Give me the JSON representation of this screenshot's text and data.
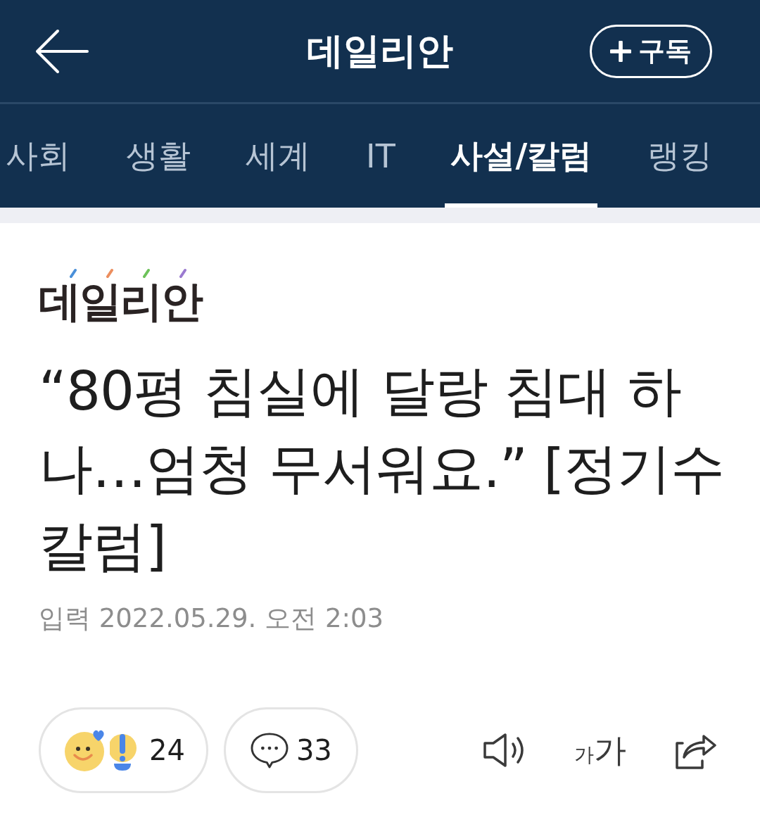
{
  "header": {
    "title": "데일리안",
    "subscribe_button": {
      "label": "구독"
    }
  },
  "tabs": [
    {
      "label": "사회",
      "selected": false
    },
    {
      "label": "생활",
      "selected": false
    },
    {
      "label": "세계",
      "selected": false
    },
    {
      "label": "IT",
      "selected": false
    },
    {
      "label": "사설/칼럼",
      "selected": true
    },
    {
      "label": "랭킹",
      "selected": false
    }
  ],
  "article": {
    "source_logo": "데일리안",
    "headline": "“80평 침실에 달랑 침대 하나…엄청 무서워요.” [정기수 칼럼]",
    "published": "입력 2022.05.29. 오전 2:03"
  },
  "actions": {
    "reactions": {
      "count": "24"
    },
    "comments": {
      "count": "33"
    },
    "font_size_button": {
      "small": "가",
      "large": "가"
    }
  }
}
